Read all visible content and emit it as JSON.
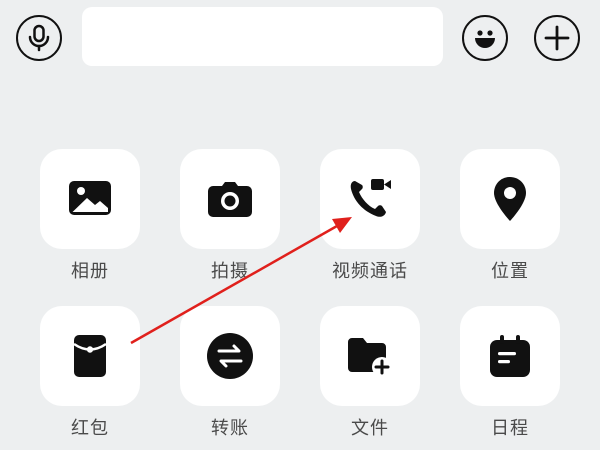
{
  "input_bar": {
    "voice_icon": "microphone-icon",
    "text_value": "",
    "emoji_icon": "smiley-icon",
    "more_icon": "plus-icon"
  },
  "panel": {
    "items": [
      {
        "label": "相册",
        "icon": "image-icon"
      },
      {
        "label": "拍摄",
        "icon": "camera-icon"
      },
      {
        "label": "视频通话",
        "icon": "video-call-icon"
      },
      {
        "label": "位置",
        "icon": "location-pin-icon"
      },
      {
        "label": "红包",
        "icon": "red-packet-icon"
      },
      {
        "label": "转账",
        "icon": "transfer-icon"
      },
      {
        "label": "文件",
        "icon": "folder-add-icon"
      },
      {
        "label": "日程",
        "icon": "calendar-icon"
      }
    ]
  },
  "annotation": {
    "arrow_color": "#e0201c",
    "from": "红包",
    "to": "视频通话"
  }
}
